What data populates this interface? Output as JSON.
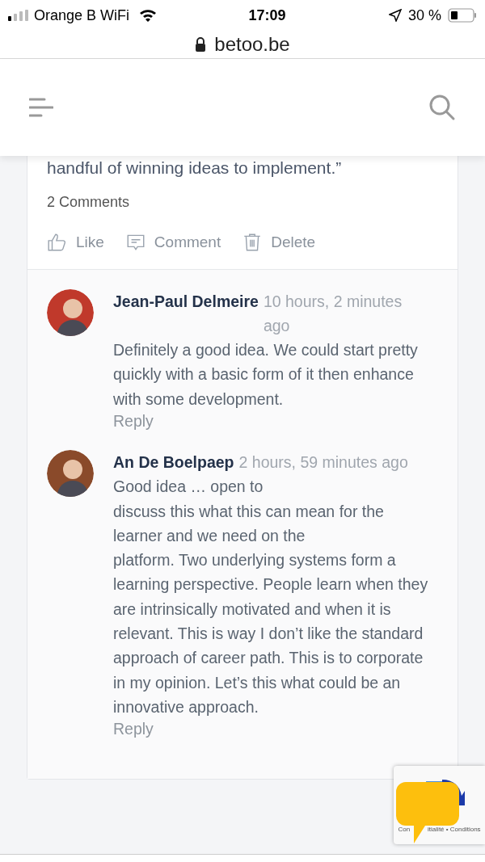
{
  "status_bar": {
    "carrier": "Orange B WiFi",
    "time": "17:09",
    "battery": "30 %"
  },
  "url_bar": {
    "domain": "betoo.be"
  },
  "post": {
    "cut_text": "handful of winning ideas to implement.”",
    "comment_count": "2 Comments",
    "actions": [
      {
        "kind": "like",
        "label": "Like"
      },
      {
        "kind": "comment",
        "label": "Comment"
      },
      {
        "kind": "delete",
        "label": "Delete"
      }
    ]
  },
  "comments": [
    {
      "author": "Jean-Paul Delmeire",
      "time": "10 hours, 2 minutes ago",
      "text": "Definitely a good idea. We could start pretty quickly with a basic form of it then enhance with some development.",
      "reply": "Reply"
    },
    {
      "author": "An De Boelpaep",
      "time": "2 hours, 59 minutes ago",
      "text": "Good idea … open to\ndiscuss this what this can mean for the learner and we need on the\nplatform.  Two underlying systems form a learning perspective.  People learn when they are intrinsically motivated and when it is relevant.    This is way I don’t like the standard\napproach of  career path.  This is to corporate in my opinion.  Let’s this what could be an innovative approach.",
      "reply": "Reply"
    }
  ],
  "recaptcha": {
    "left": "Con",
    "right": "itialité • Conditions"
  }
}
